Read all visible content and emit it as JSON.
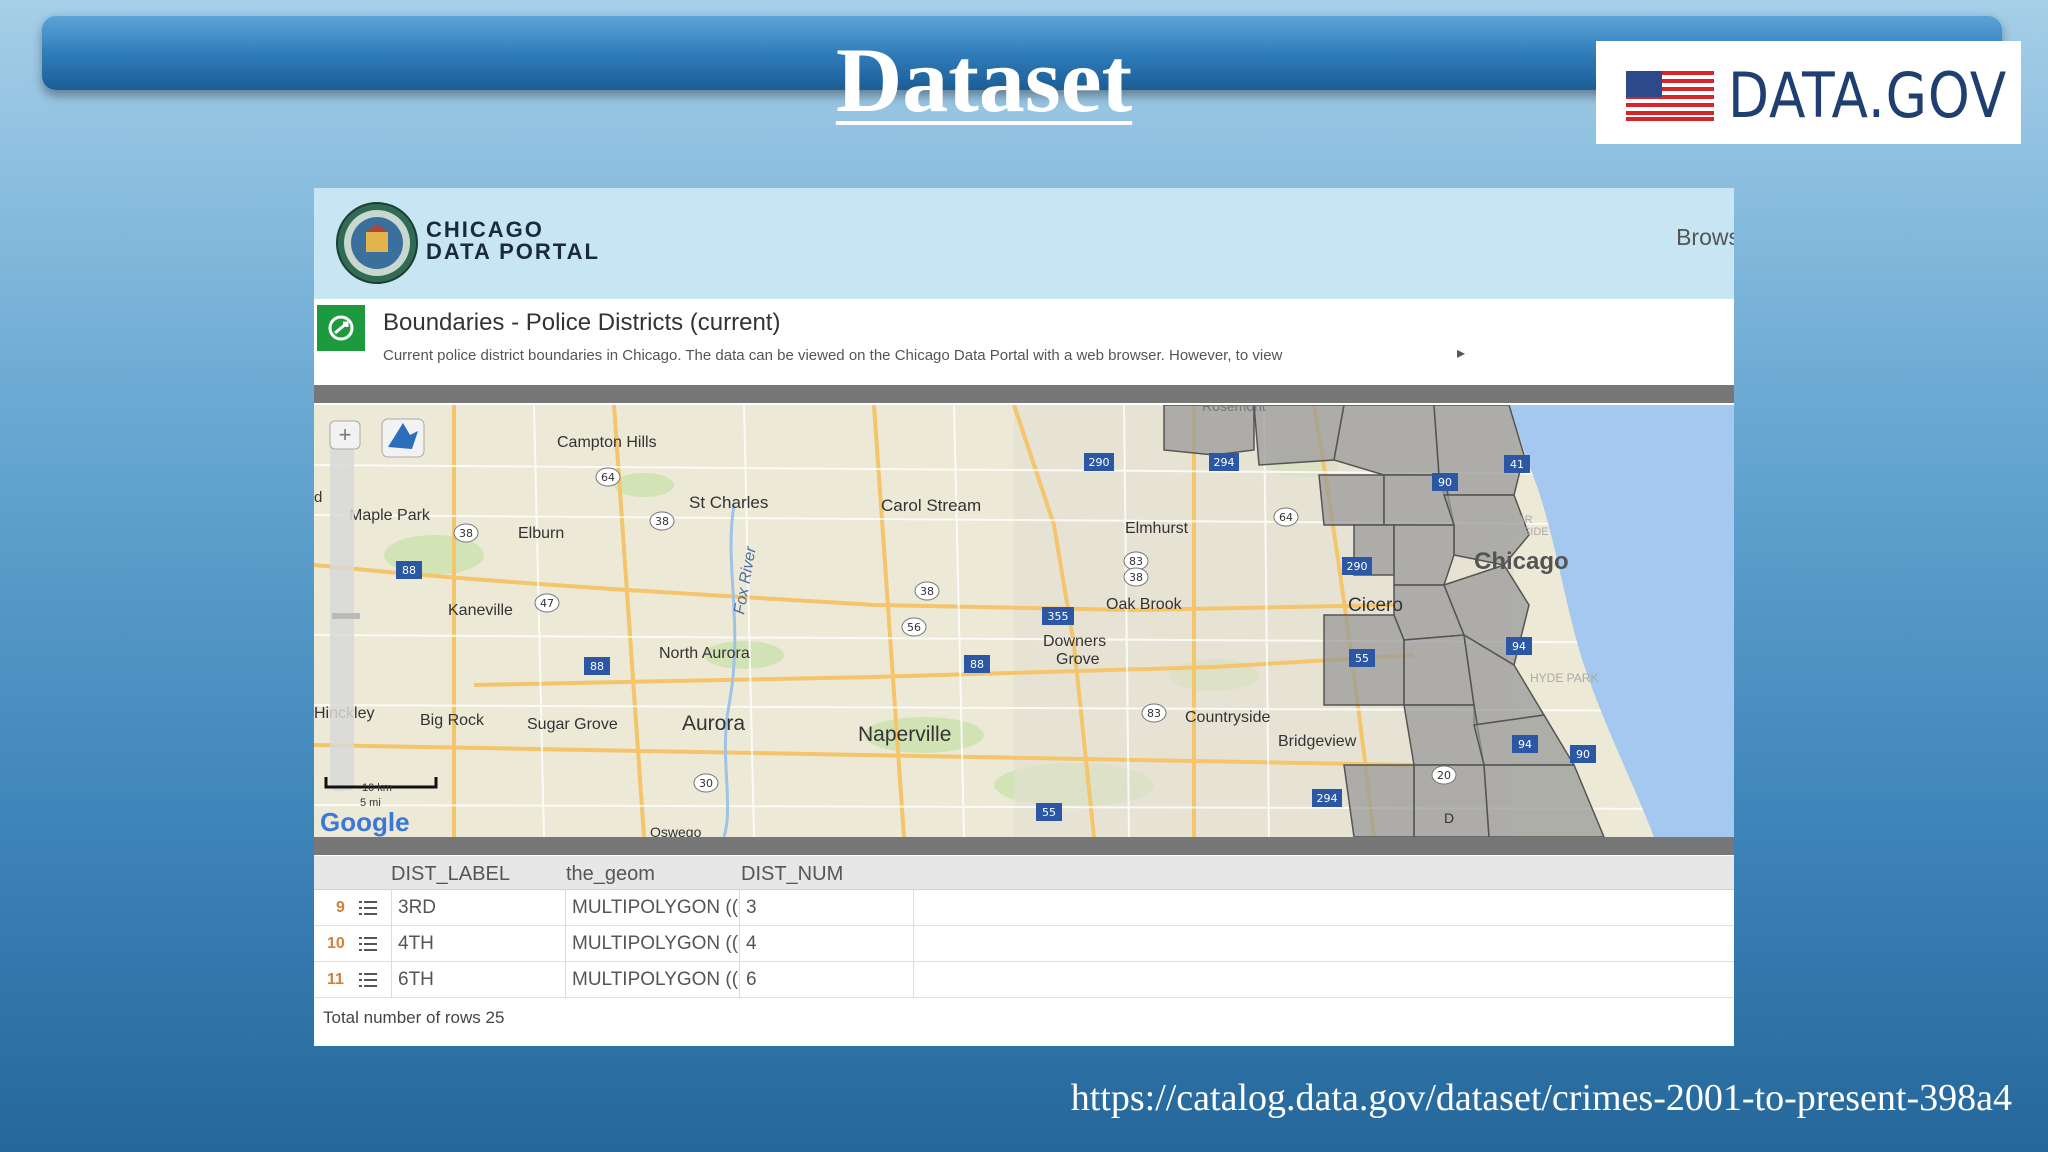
{
  "slide": {
    "title": "Dataset",
    "source_url": "https://catalog.data.gov/dataset/crimes-2001-to-present-398a4"
  },
  "logo": {
    "text": "DATA.GOV"
  },
  "portal": {
    "name_line1": "CHICAGO",
    "name_line2": "DATA PORTAL",
    "browse": "Brows"
  },
  "dataset": {
    "title": "Boundaries - Police Districts (current)",
    "description": "Current police district boundaries in Chicago. The data can be viewed on the Chicago Data Portal with a web browser. However, to view",
    "more_glyph": "▸"
  },
  "map": {
    "places": [
      {
        "name": "Campton Hills"
      },
      {
        "name": "Maple Park"
      },
      {
        "name": "Elburn"
      },
      {
        "name": "St Charles"
      },
      {
        "name": "Carol Stream"
      },
      {
        "name": "Elmhurst"
      },
      {
        "name": "Kaneville"
      },
      {
        "name": "Fox River"
      },
      {
        "name": "Oak Brook"
      },
      {
        "name": "Cicero"
      },
      {
        "name": "Chicago"
      },
      {
        "name": "North Aurora"
      },
      {
        "name": "Downers"
      },
      {
        "name": "Grove"
      },
      {
        "name": "Hinckley"
      },
      {
        "name": "Big Rock"
      },
      {
        "name": "Sugar Grove"
      },
      {
        "name": "Aurora"
      },
      {
        "name": "Naperville"
      },
      {
        "name": "Countryside"
      },
      {
        "name": "Bridgeview"
      },
      {
        "name": "NEAR"
      },
      {
        "name": "NORTH SIDE"
      },
      {
        "name": "HYDE PARK"
      },
      {
        "name": "Rosemont"
      },
      {
        "name": "Oswego"
      },
      {
        "name": "d"
      },
      {
        "name": "D"
      }
    ],
    "shields": [
      "64",
      "38",
      "290",
      "294",
      "64",
      "88",
      "38",
      "47",
      "38",
      "355",
      "56",
      "88",
      "88",
      "83",
      "83",
      "38",
      "90",
      "290",
      "94",
      "55",
      "94",
      "90",
      "294",
      "20",
      "30",
      "55",
      "83",
      "47",
      "41"
    ],
    "scale_km": "10 km",
    "scale_mi": "5 mi",
    "google": "Google"
  },
  "table": {
    "columns": [
      "DIST_LABEL",
      "the_geom",
      "DIST_NUM"
    ],
    "rows": [
      {
        "num": "9",
        "label": "3RD",
        "geom": "MULTIPOLYGON ((",
        "dist": "3"
      },
      {
        "num": "10",
        "label": "4TH",
        "geom": "MULTIPOLYGON ((",
        "dist": "4"
      },
      {
        "num": "11",
        "label": "6TH",
        "geom": "MULTIPOLYGON ((",
        "dist": "6"
      }
    ],
    "footer": "Total number of rows 25"
  },
  "colors": {
    "banner": "#2e7bb8",
    "portal_header": "#c7e5f3",
    "dataset_icon": "#1e9a3e",
    "row_number": "#d4813a",
    "lake": "#a4c8f0",
    "district_fill": "#9a9a9a"
  }
}
